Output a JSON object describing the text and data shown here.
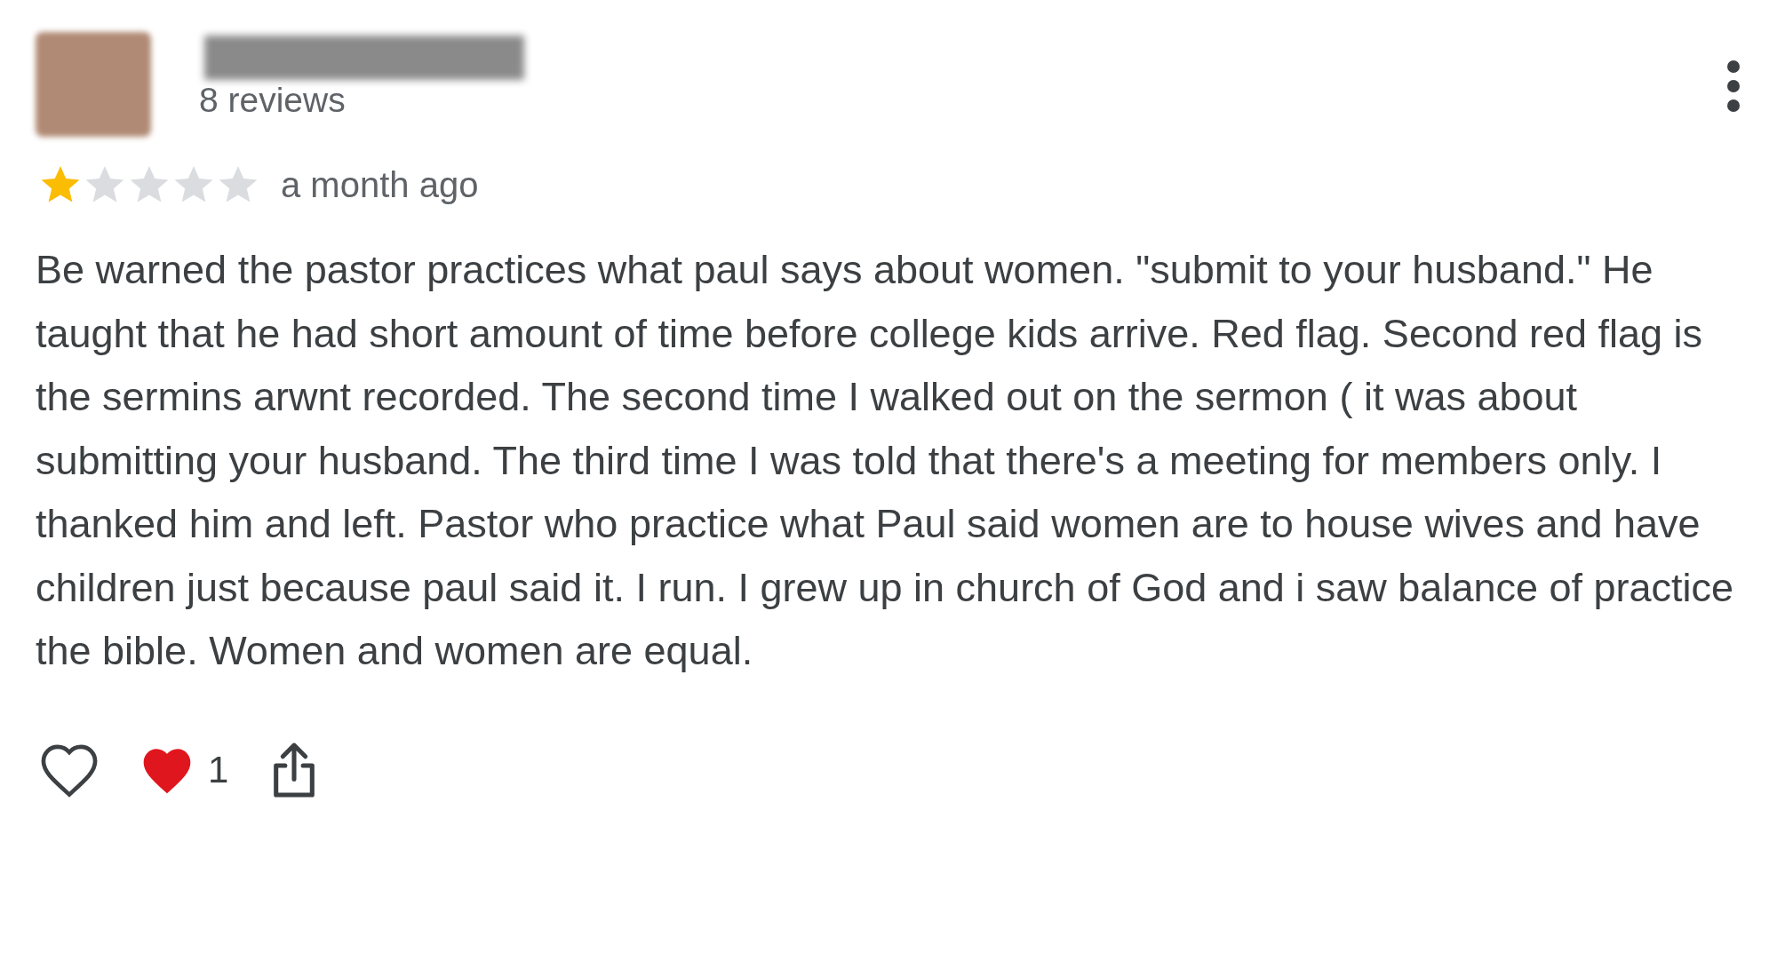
{
  "review": {
    "reviewer": {
      "reviews": "8 reviews"
    },
    "stars": 1,
    "time": "a month ago",
    "text": "Be warned the pastor practices what paul says about women. \"submit to your husband.\" He taught that he had short amount of time before college kids arrive. Red flag. Second red flag is the sermins arwnt recorded. The second time I walked out on the sermon ( it was about submitting your husband. The third time I was told that there's a meeting for members only. I thanked him and left. Pastor who practice what Paul said women are to house wives and have children just because paul said it. I run. I grew up in church of God and i saw balance of practice the bible. Women and women are equal.",
    "reaction_count": "1"
  }
}
